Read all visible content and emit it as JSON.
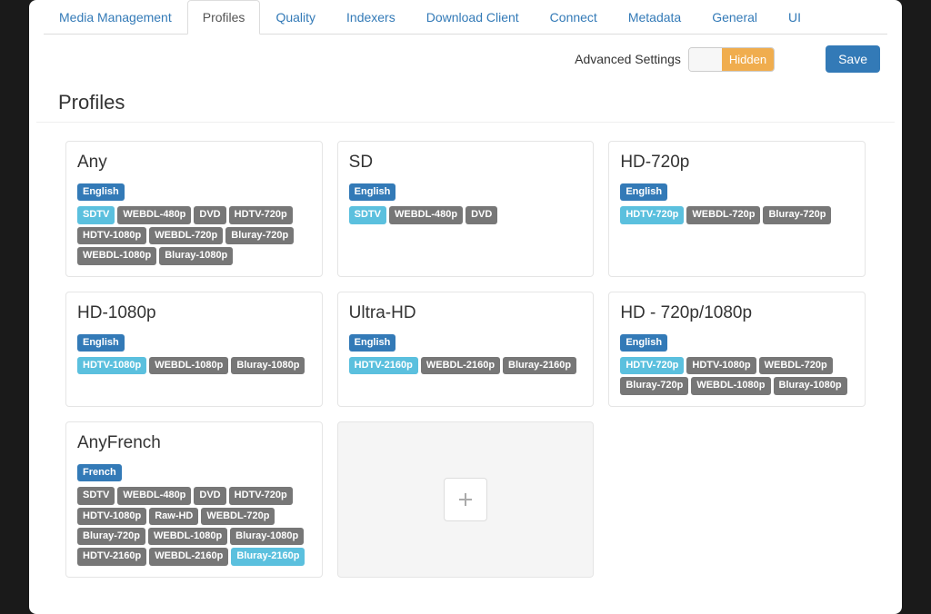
{
  "tabs": [
    "Media Management",
    "Profiles",
    "Quality",
    "Indexers",
    "Download Client",
    "Connect",
    "Metadata",
    "General",
    "UI"
  ],
  "activeTab": 1,
  "advancedSettings": {
    "label": "Advanced Settings",
    "state": "Hidden"
  },
  "saveLabel": "Save",
  "sectionTitle": "Profiles",
  "profiles": [
    {
      "name": "Any",
      "language": "English",
      "cutoff": "SDTV",
      "qualities": [
        "WEBDL-480p",
        "DVD",
        "HDTV-720p",
        "HDTV-1080p",
        "WEBDL-720p",
        "Bluray-720p",
        "WEBDL-1080p",
        "Bluray-1080p"
      ]
    },
    {
      "name": "SD",
      "language": "English",
      "cutoff": "SDTV",
      "qualities": [
        "WEBDL-480p",
        "DVD"
      ]
    },
    {
      "name": "HD-720p",
      "language": "English",
      "cutoff": "HDTV-720p",
      "qualities": [
        "WEBDL-720p",
        "Bluray-720p"
      ]
    },
    {
      "name": "HD-1080p",
      "language": "English",
      "cutoff": "HDTV-1080p",
      "qualities": [
        "WEBDL-1080p",
        "Bluray-1080p"
      ]
    },
    {
      "name": "Ultra-HD",
      "language": "English",
      "cutoff": "HDTV-2160p",
      "qualities": [
        "WEBDL-2160p",
        "Bluray-2160p"
      ]
    },
    {
      "name": "HD - 720p/1080p",
      "language": "English",
      "cutoff": "HDTV-720p",
      "qualities": [
        "HDTV-1080p",
        "WEBDL-720p",
        "Bluray-720p",
        "WEBDL-1080p",
        "Bluray-1080p"
      ]
    },
    {
      "name": "AnyFrench",
      "language": "French",
      "cutoff": null,
      "cutoffLast": "Bluray-2160p",
      "qualities": [
        "SDTV",
        "WEBDL-480p",
        "DVD",
        "HDTV-720p",
        "HDTV-1080p",
        "Raw-HD",
        "WEBDL-720p",
        "Bluray-720p",
        "WEBDL-1080p",
        "Bluray-1080p",
        "HDTV-2160p",
        "WEBDL-2160p"
      ]
    }
  ]
}
